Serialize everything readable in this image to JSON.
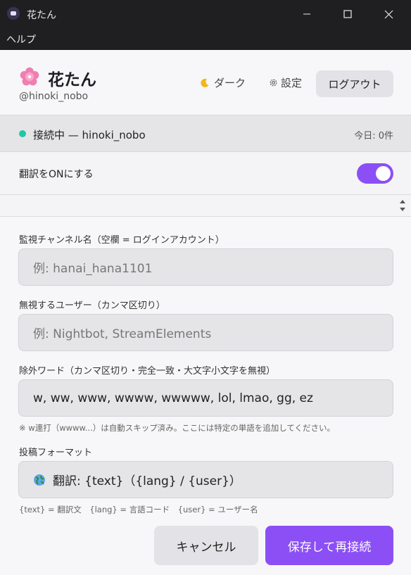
{
  "window": {
    "title": "花たん",
    "app_icon": "app-logo-icon",
    "minimize_icon": "minimize-icon",
    "maximize_icon": "maximize-icon",
    "close_icon": "close-icon"
  },
  "menu": {
    "help": "ヘルプ"
  },
  "header": {
    "flower_icon": "cherry-blossom-icon",
    "app_name": "花たん",
    "handle": "@hinoki_nobo",
    "dark_icon": "moon-icon",
    "dark_label": "ダーク",
    "settings_icon": "gear-icon",
    "settings_label": "設定",
    "logout_label": "ログアウト"
  },
  "status": {
    "text": "接続中 — hinoki_nobo",
    "today": "今日: 0件",
    "dot_color": "#1ec8a4"
  },
  "translate_toggle": {
    "label": "翻訳をONにする",
    "on": true,
    "color": "#8b4ff5"
  },
  "form": {
    "channel": {
      "label": "監視チャンネル名（空欄 = ログインアカウント）",
      "value": "",
      "placeholder": "例: hanai_hana1101"
    },
    "ignore_users": {
      "label": "無視するユーザー（カンマ区切り）",
      "value": "",
      "placeholder": "例: Nightbot, StreamElements"
    },
    "exclude_words": {
      "label": "除外ワード（カンマ区切り・完全一致・大文字小文字を無視）",
      "value": "w, ww, www, wwww, wwwww, lol, lmao, gg, ez",
      "hint": "※ w連打（wwww...）は自動スキップ済み。ここには特定の単語を追加してください。"
    },
    "post_format": {
      "label": "投稿フォーマット",
      "icon": "globe-icon",
      "value": "翻訳: {text}（{lang} / {user}）",
      "hint": "{text} = 翻訳文　{lang} = 言語コード　{user} = ユーザー名"
    }
  },
  "actions": {
    "cancel": "キャンセル",
    "save": "保存して再接続",
    "accent": "#8b4ff5"
  }
}
